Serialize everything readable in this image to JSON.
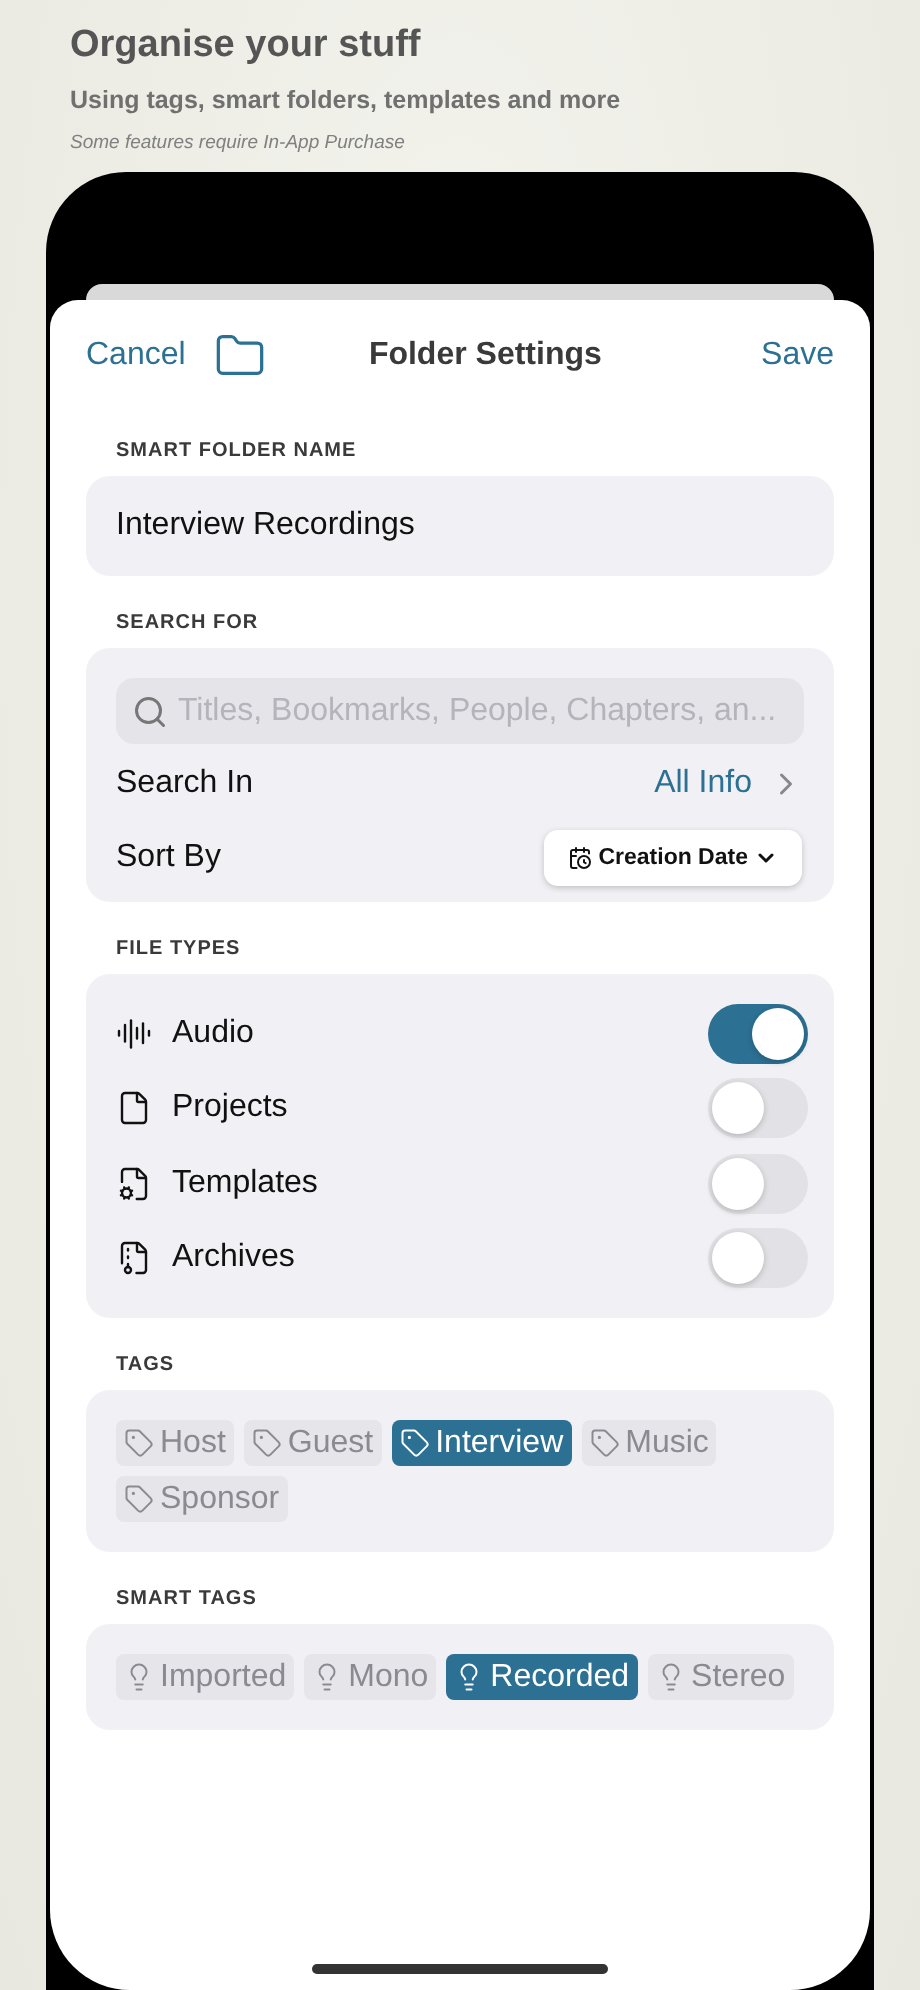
{
  "header": {
    "title": "**Organise** your stuff",
    "subtitle": "Using tags, smart folders, templates and more",
    "note": "Some features require In-App Purchase"
  },
  "nav": {
    "cancel": "Cancel",
    "title": "Folder Settings",
    "save": "Save"
  },
  "name_section": {
    "label": "SMART FOLDER NAME",
    "value": "Interview Recordings"
  },
  "search_section": {
    "label": "SEARCH FOR",
    "placeholder": "Titles, Bookmarks, People, Chapters, an...",
    "search_in": {
      "label": "Search In",
      "value": "All Info"
    },
    "sort_by": {
      "label": "Sort By",
      "value": "Creation Date"
    }
  },
  "file_types": {
    "label": "FILE TYPES",
    "items": [
      {
        "kind": "audio",
        "label": "Audio",
        "on": true
      },
      {
        "kind": "project",
        "label": "Projects",
        "on": false
      },
      {
        "kind": "template",
        "label": "Templates",
        "on": false
      },
      {
        "kind": "archive",
        "label": "Archives",
        "on": false
      }
    ]
  },
  "tags": {
    "label": "TAGS",
    "items": [
      {
        "label": "Host",
        "selected": false
      },
      {
        "label": "Guest",
        "selected": false
      },
      {
        "label": "Interview",
        "selected": true
      },
      {
        "label": "Music",
        "selected": false
      },
      {
        "label": "Sponsor",
        "selected": false
      }
    ]
  },
  "smart_tags": {
    "label": "SMART TAGS",
    "items": [
      {
        "label": "Imported",
        "selected": false
      },
      {
        "label": "Mono",
        "selected": false
      },
      {
        "label": "Recorded",
        "selected": true
      },
      {
        "label": "Stereo",
        "selected": false
      }
    ]
  }
}
